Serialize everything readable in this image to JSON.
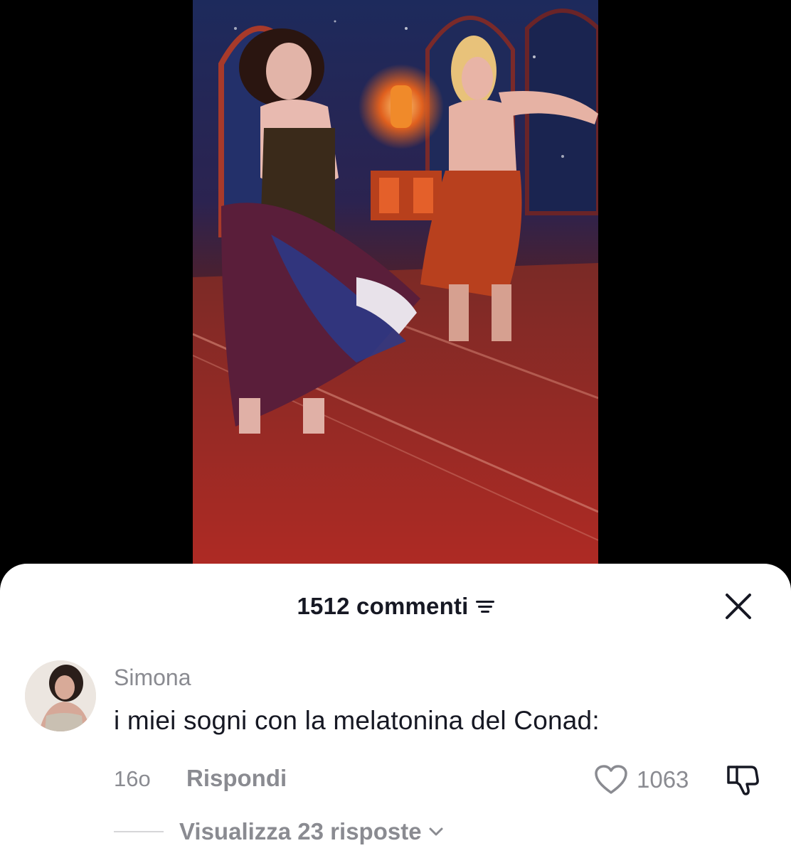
{
  "video": {
    "description_icon": "video-frame"
  },
  "comments_sheet": {
    "count_label": "1512 commenti",
    "filter_icon": "filter-icon",
    "close_icon": "close-icon"
  },
  "comment": {
    "username": "Simona",
    "text": "i miei sogni con la melatonina del Conad:",
    "time_ago": "16o",
    "reply_label": "Rispondi",
    "like_count": "1063",
    "like_icon": "heart-outline-icon",
    "dislike_icon": "thumbs-down-icon",
    "view_replies_label": "Visualizza 23 risposte"
  },
  "colors": {
    "primary_text": "#161823",
    "secondary_text": "#8a8b91",
    "sheet_background": "#ffffff",
    "page_background": "#000000"
  }
}
